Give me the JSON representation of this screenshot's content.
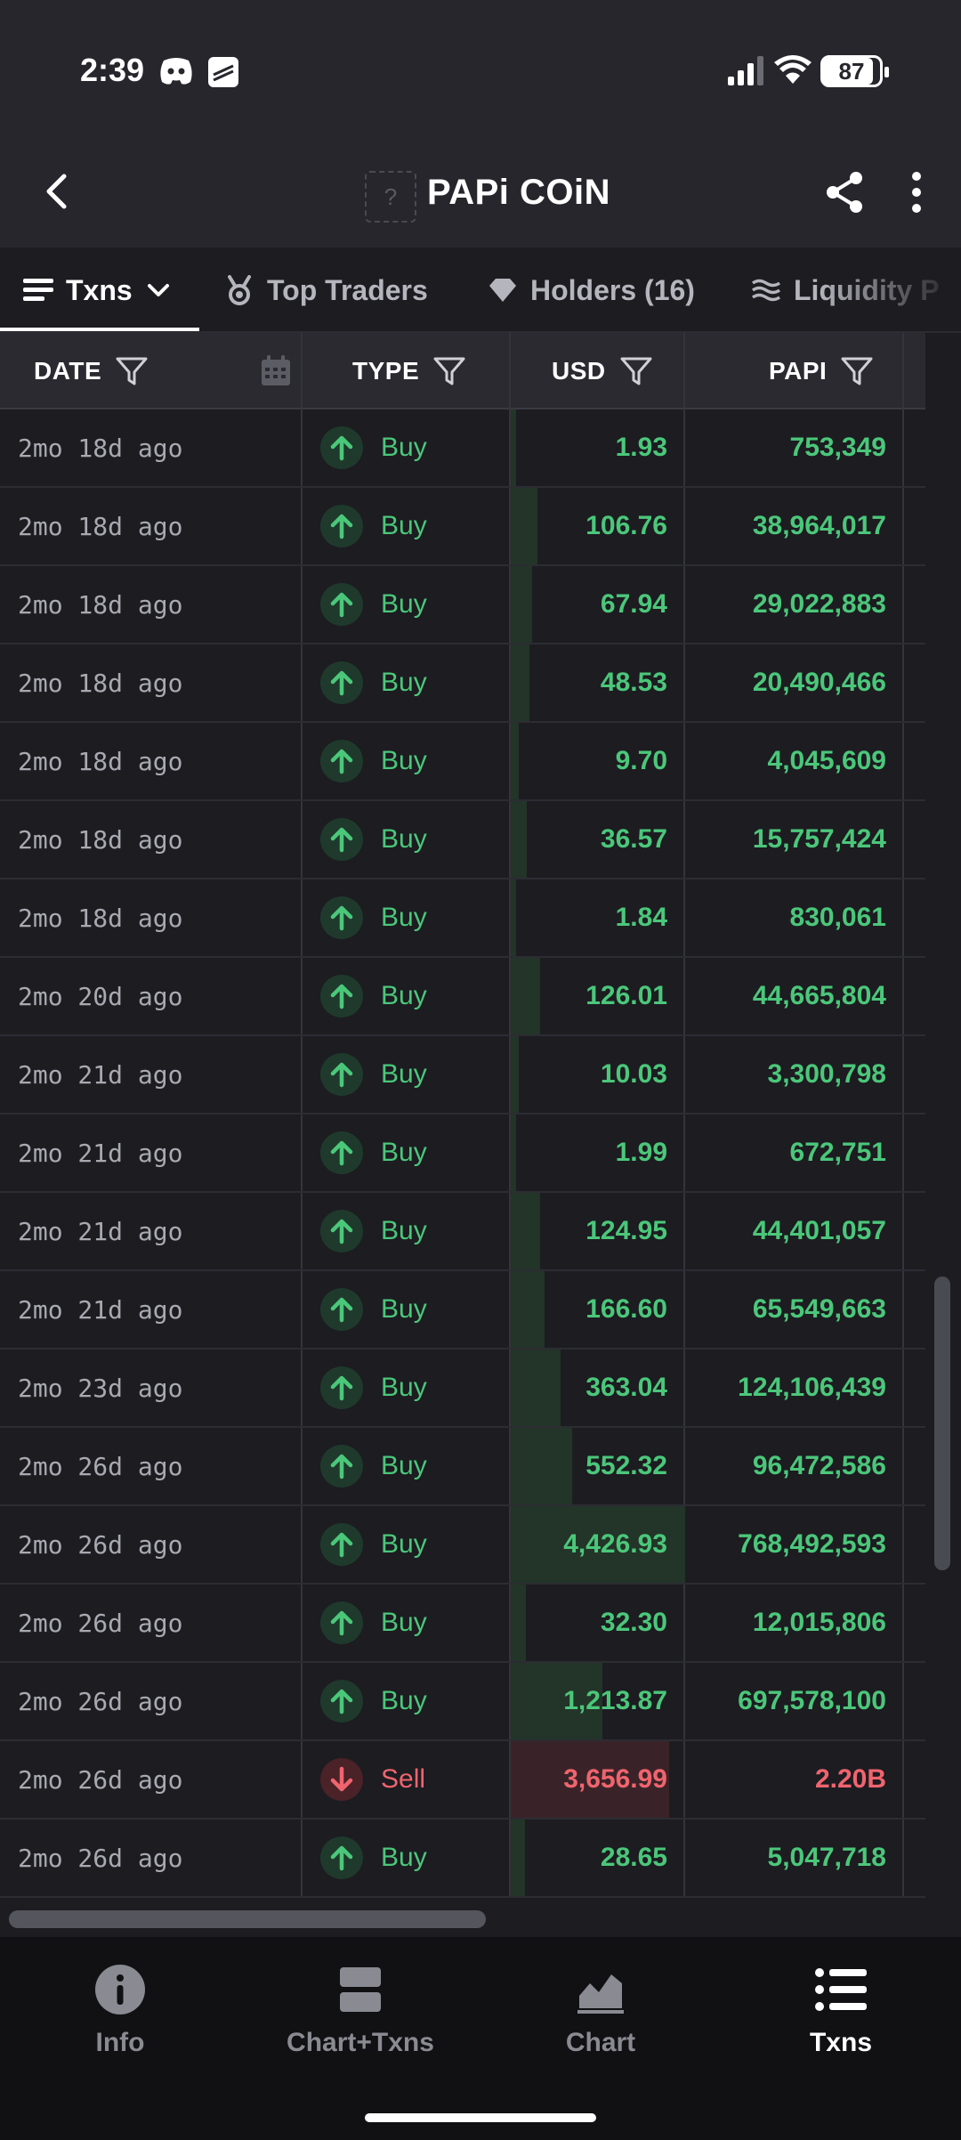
{
  "status_bar": {
    "time": "2:39",
    "battery": "87",
    "battery_level_pct": 87,
    "icons": [
      "discord-icon",
      "app-icon",
      "signal-icon",
      "wifi-icon",
      "battery-icon"
    ]
  },
  "header": {
    "title": "PAPi COiN",
    "logo_placeholder": "?",
    "icons": [
      "back-icon",
      "share-icon",
      "more-icon"
    ]
  },
  "tabs": [
    {
      "label": "Txns",
      "icon": "list-icon",
      "active": true
    },
    {
      "label": "Top Traders",
      "icon": "medal-icon",
      "active": false
    },
    {
      "label": "Holders (16)",
      "icon": "diamond-icon",
      "active": false
    },
    {
      "label": "Liquidity P",
      "icon": "waves-icon",
      "active": false
    }
  ],
  "table": {
    "columns": [
      {
        "label": "DATE"
      },
      {
        "label": "TYPE"
      },
      {
        "label": "USD"
      },
      {
        "label": "PAPI"
      }
    ],
    "rows": [
      {
        "date": "2mo 18d ago",
        "type": "Buy",
        "usd": "1.93",
        "papi": "753,349",
        "usd_value": 1.93
      },
      {
        "date": "2mo 18d ago",
        "type": "Buy",
        "usd": "106.76",
        "papi": "38,964,017",
        "usd_value": 106.76
      },
      {
        "date": "2mo 18d ago",
        "type": "Buy",
        "usd": "67.94",
        "papi": "29,022,883",
        "usd_value": 67.94
      },
      {
        "date": "2mo 18d ago",
        "type": "Buy",
        "usd": "48.53",
        "papi": "20,490,466",
        "usd_value": 48.53
      },
      {
        "date": "2mo 18d ago",
        "type": "Buy",
        "usd": "9.70",
        "papi": "4,045,609",
        "usd_value": 9.7
      },
      {
        "date": "2mo 18d ago",
        "type": "Buy",
        "usd": "36.57",
        "papi": "15,757,424",
        "usd_value": 36.57
      },
      {
        "date": "2mo 18d ago",
        "type": "Buy",
        "usd": "1.84",
        "papi": "830,061",
        "usd_value": 1.84
      },
      {
        "date": "2mo 20d ago",
        "type": "Buy",
        "usd": "126.01",
        "papi": "44,665,804",
        "usd_value": 126.01
      },
      {
        "date": "2mo 21d ago",
        "type": "Buy",
        "usd": "10.03",
        "papi": "3,300,798",
        "usd_value": 10.03
      },
      {
        "date": "2mo 21d ago",
        "type": "Buy",
        "usd": "1.99",
        "papi": "672,751",
        "usd_value": 1.99
      },
      {
        "date": "2mo 21d ago",
        "type": "Buy",
        "usd": "124.95",
        "papi": "44,401,057",
        "usd_value": 124.95
      },
      {
        "date": "2mo 21d ago",
        "type": "Buy",
        "usd": "166.60",
        "papi": "65,549,663",
        "usd_value": 166.6
      },
      {
        "date": "2mo 23d ago",
        "type": "Buy",
        "usd": "363.04",
        "papi": "124,106,439",
        "usd_value": 363.04
      },
      {
        "date": "2mo 26d ago",
        "type": "Buy",
        "usd": "552.32",
        "papi": "96,472,586",
        "usd_value": 552.32
      },
      {
        "date": "2mo 26d ago",
        "type": "Buy",
        "usd": "4,426.93",
        "papi": "768,492,593",
        "usd_value": 4426.93
      },
      {
        "date": "2mo 26d ago",
        "type": "Buy",
        "usd": "32.30",
        "papi": "12,015,806",
        "usd_value": 32.3
      },
      {
        "date": "2mo 26d ago",
        "type": "Buy",
        "usd": "1,213.87",
        "papi": "697,578,100",
        "usd_value": 1213.87
      },
      {
        "date": "2mo 26d ago",
        "type": "Sell",
        "usd": "3,656.99",
        "papi": "2.20B",
        "usd_value": 3656.99
      },
      {
        "date": "2mo 26d ago",
        "type": "Buy",
        "usd": "28.65",
        "papi": "5,047,718",
        "usd_value": 28.65
      }
    ]
  },
  "bottom_nav": [
    {
      "label": "Info",
      "icon": "info-icon",
      "active": false
    },
    {
      "label": "Chart+Txns",
      "icon": "split-view-icon",
      "active": false
    },
    {
      "label": "Chart",
      "icon": "chart-icon",
      "active": false
    },
    {
      "label": "Txns",
      "icon": "list-icon",
      "active": true
    }
  ],
  "colors": {
    "buy": "#4bc77a",
    "sell": "#f0646e",
    "background": "#1c1c21",
    "header": "#26262c"
  }
}
